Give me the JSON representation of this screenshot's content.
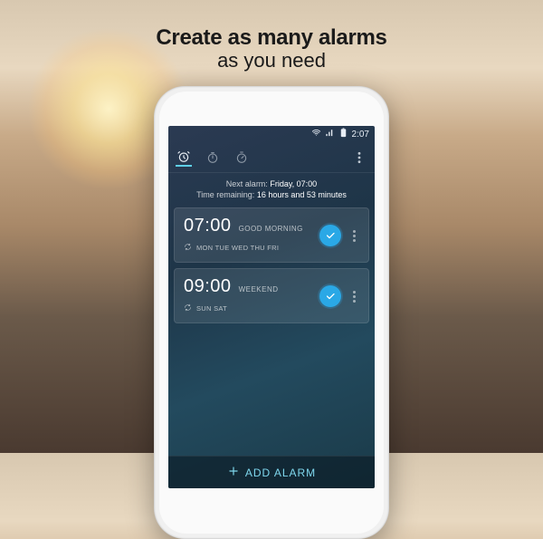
{
  "promo": {
    "line1": "Create as many alarms",
    "line2": "as you need"
  },
  "statusbar": {
    "time": "2:07"
  },
  "nextalarm": {
    "prefix": "Next alarm:",
    "value": "Friday, 07:00",
    "remaining_prefix": "Time remaining:",
    "remaining_value": "16 hours and 53 minutes"
  },
  "alarms": [
    {
      "time": "07:00",
      "label": "GOOD MORNING",
      "days": "MON TUE WED THU FRI",
      "enabled": true
    },
    {
      "time": "09:00",
      "label": "WEEKEND",
      "days": "SUN SAT",
      "enabled": true
    }
  ],
  "actions": {
    "add_label": "ADD ALARM"
  }
}
